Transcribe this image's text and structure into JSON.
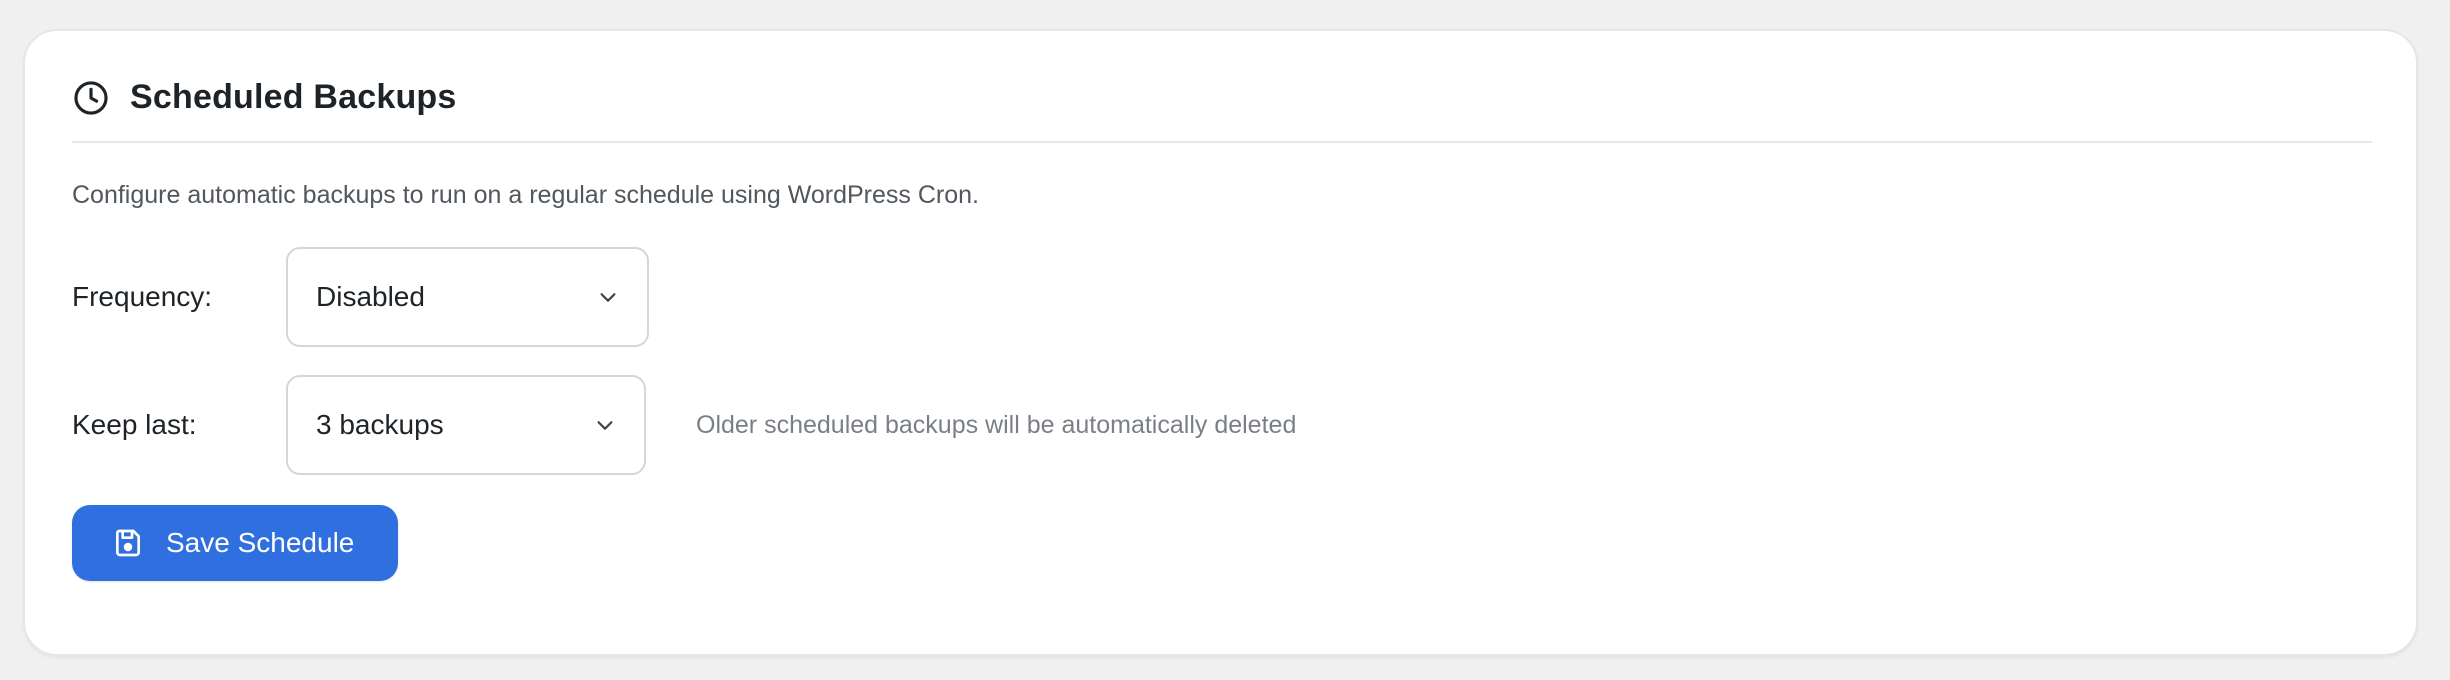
{
  "section": {
    "title": "Scheduled Backups",
    "icon": "clock-icon",
    "description": "Configure automatic backups to run on a regular schedule using WordPress Cron."
  },
  "form": {
    "frequency": {
      "label": "Frequency:",
      "selected": "Disabled"
    },
    "keep_last": {
      "label": "Keep last:",
      "selected": "3 backups",
      "hint": "Older scheduled backups will be automatically deleted"
    }
  },
  "actions": {
    "save_label": "Save Schedule",
    "save_icon": "floppy-disk-icon"
  },
  "colors": {
    "accent": "#2f6fdf",
    "text": "#1d2327",
    "muted": "#7a7f85",
    "background": "#f0f0f0"
  }
}
